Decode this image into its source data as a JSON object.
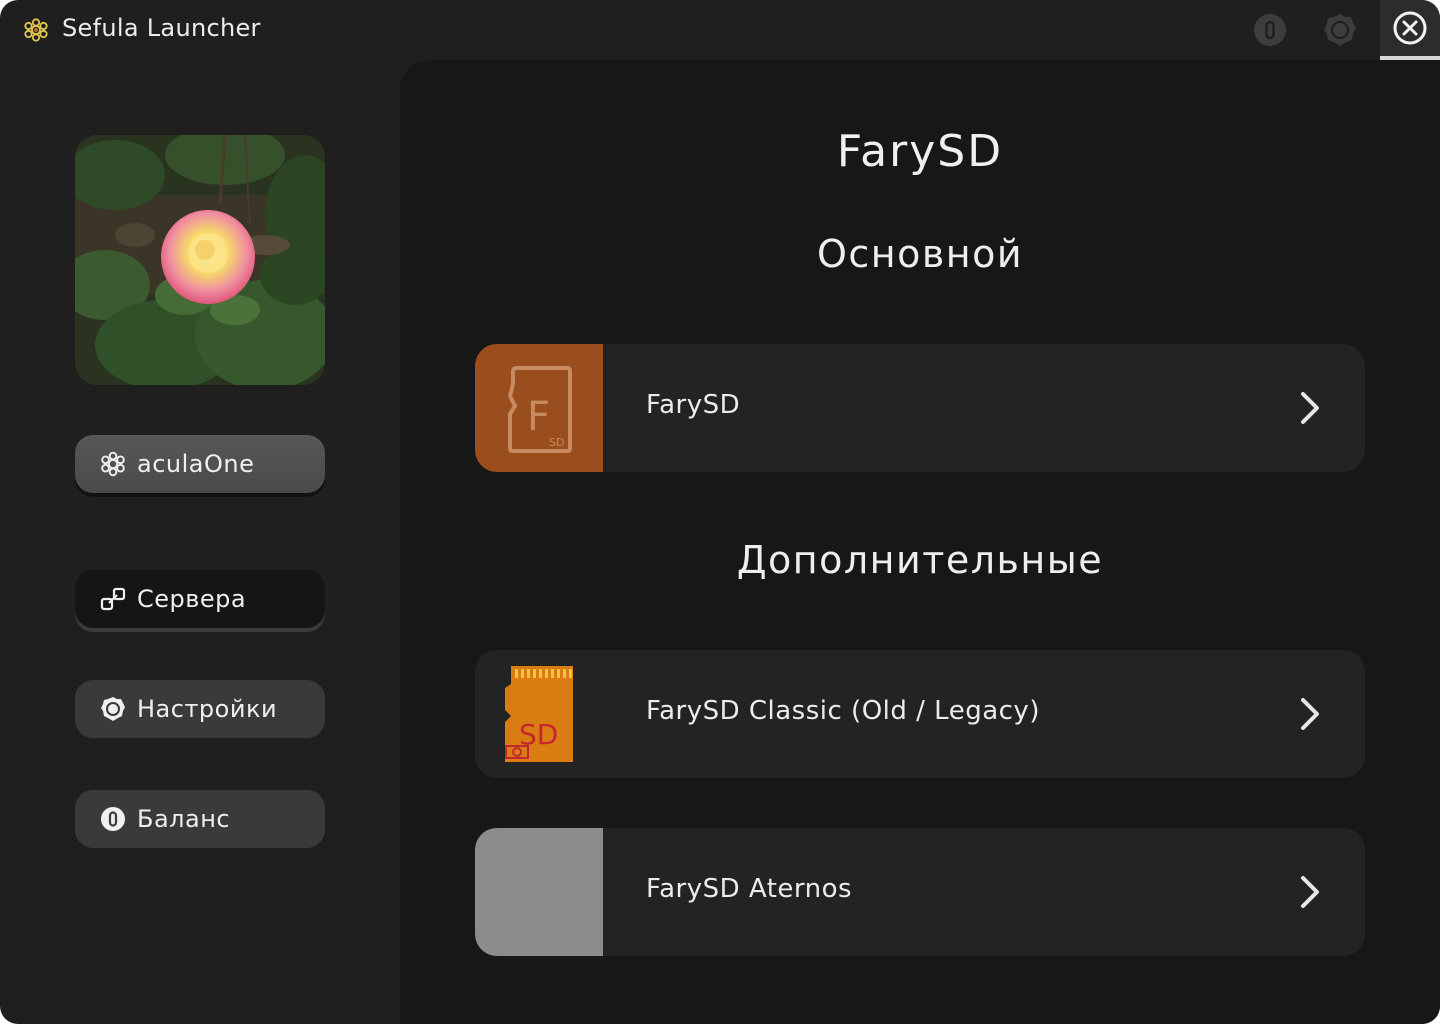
{
  "app": {
    "title": "Sefula Launcher",
    "icons": {
      "logo": "flower-logo-icon",
      "balance": "coin-icon",
      "settings": "gear-icon",
      "close": "close-circle-icon"
    }
  },
  "sidebar": {
    "avatar": "rose-photo",
    "user": {
      "label": "aculaOne",
      "icon": "flower-icon"
    },
    "items": [
      {
        "label": "Сервера",
        "icon": "link-icon"
      },
      {
        "label": "Настройки",
        "icon": "gear-icon"
      },
      {
        "label": "Баланс",
        "icon": "coin-icon"
      }
    ]
  },
  "main": {
    "title": "FarySD",
    "section_main": "Основной",
    "section_extra": "Дополнительные",
    "cards": [
      {
        "label": "FarySD",
        "thumb": "farysd-sd-card-icon",
        "thumb_color": "#9b4e1d"
      },
      {
        "label": "FarySD Classic (Old / Legacy)",
        "thumb": "legacy-sd-card-icon",
        "thumb_color": "#232323"
      },
      {
        "label": "FarySD Aternos",
        "thumb": "placeholder-thumbnail",
        "thumb_color": "#8c8c8c"
      }
    ]
  },
  "colors": {
    "window_bg": "#1f1f1f",
    "panel_bg": "#171717",
    "card_bg": "#232323",
    "accent_orange": "#9b4e1d"
  }
}
